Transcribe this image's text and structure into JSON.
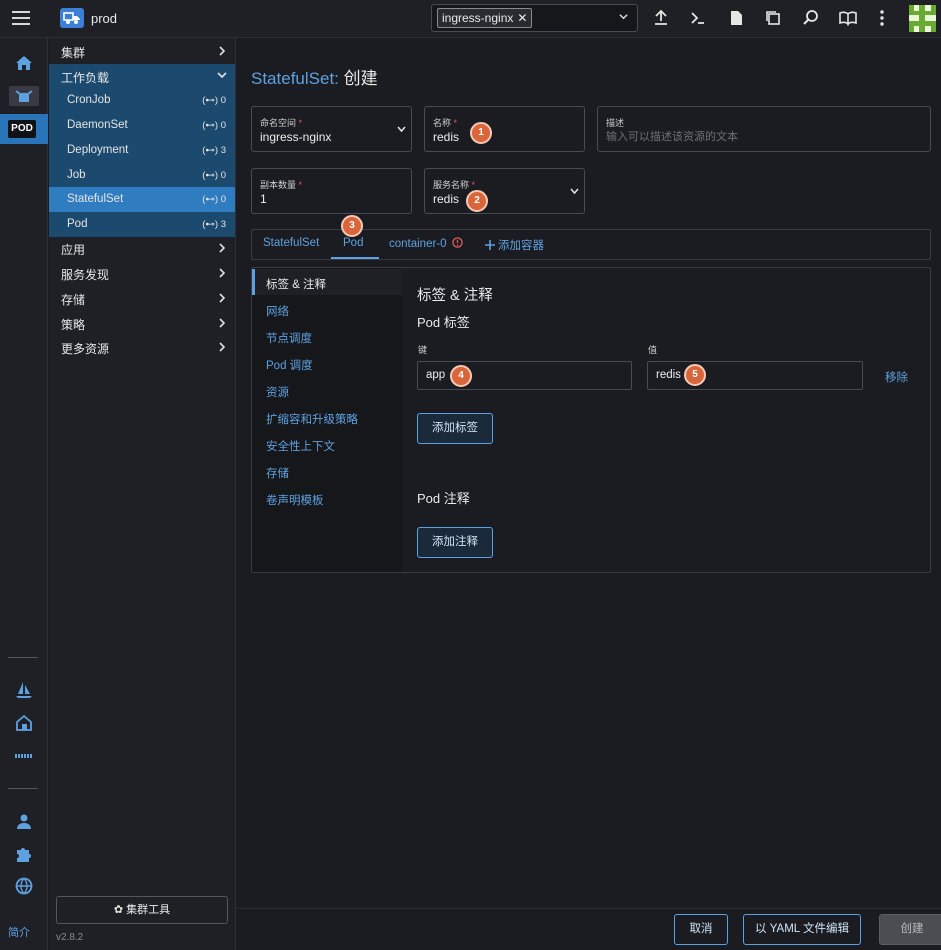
{
  "header": {
    "cluster_name": "prod",
    "namespace_chip": "ingress-nginx",
    "avatar_colors": {
      "bg": "#6aa934",
      "fg": "#eaf7d8"
    }
  },
  "rail": {
    "pod_label": "POD",
    "intro_label": "简介"
  },
  "sidebar": {
    "groups_top": [
      {
        "label": "集群"
      }
    ],
    "workload_group": "工作负载",
    "workload_items": [
      {
        "label": "CronJob",
        "count": "(⊷) 0"
      },
      {
        "label": "DaemonSet",
        "count": "(⊷) 0"
      },
      {
        "label": "Deployment",
        "count": "(⊷) 3"
      },
      {
        "label": "Job",
        "count": "(⊷) 0"
      },
      {
        "label": "StatefulSet",
        "count": "(⊷) 0",
        "active": true
      },
      {
        "label": "Pod",
        "count": "(⊷) 3"
      }
    ],
    "groups_bottom": [
      {
        "label": "应用"
      },
      {
        "label": "服务发现"
      },
      {
        "label": "存储"
      },
      {
        "label": "策略"
      },
      {
        "label": "更多资源"
      }
    ],
    "cluster_tools": "✿ 集群工具",
    "version": "v2.8.2"
  },
  "main": {
    "title_kind": "StatefulSet:",
    "title_action": "创建",
    "namespace": {
      "label": "命名空间",
      "value": "ingress-nginx"
    },
    "name": {
      "label": "名称",
      "value": "redis"
    },
    "description": {
      "label": "描述",
      "placeholder": "输入可以描述该资源的文本"
    },
    "replicas": {
      "label": "副本数量",
      "value": "1"
    },
    "service_name": {
      "label": "服务名称",
      "value": "redis"
    },
    "tabs": {
      "statefulset": "StatefulSet",
      "pod": "Pod",
      "container": "container-0",
      "add_container": "添加容器"
    },
    "panel_nav": [
      "标签 & 注释",
      "网络",
      "节点调度",
      "Pod 调度",
      "资源",
      "扩缩容和升级策略",
      "安全性上下文",
      "存储",
      "卷声明模板"
    ],
    "section_title": "标签 & 注释",
    "pod_labels_title": "Pod 标签",
    "key_label": "键",
    "value_label": "值",
    "label_key": "app",
    "label_value": "redis",
    "remove": "移除",
    "add_label": "添加标签",
    "pod_annotations_title": "Pod 注释",
    "add_annotation": "添加注释"
  },
  "badges": [
    "1",
    "2",
    "3",
    "4",
    "5"
  ],
  "footer": {
    "cancel": "取消",
    "yaml_edit": "以 YAML 文件编辑",
    "create": "创建"
  },
  "colors": {
    "accent": "#5ea1e0",
    "active_nav": "#2f7dc0",
    "workload_bg": "#1c4a6e",
    "badge": "#d9653a"
  }
}
